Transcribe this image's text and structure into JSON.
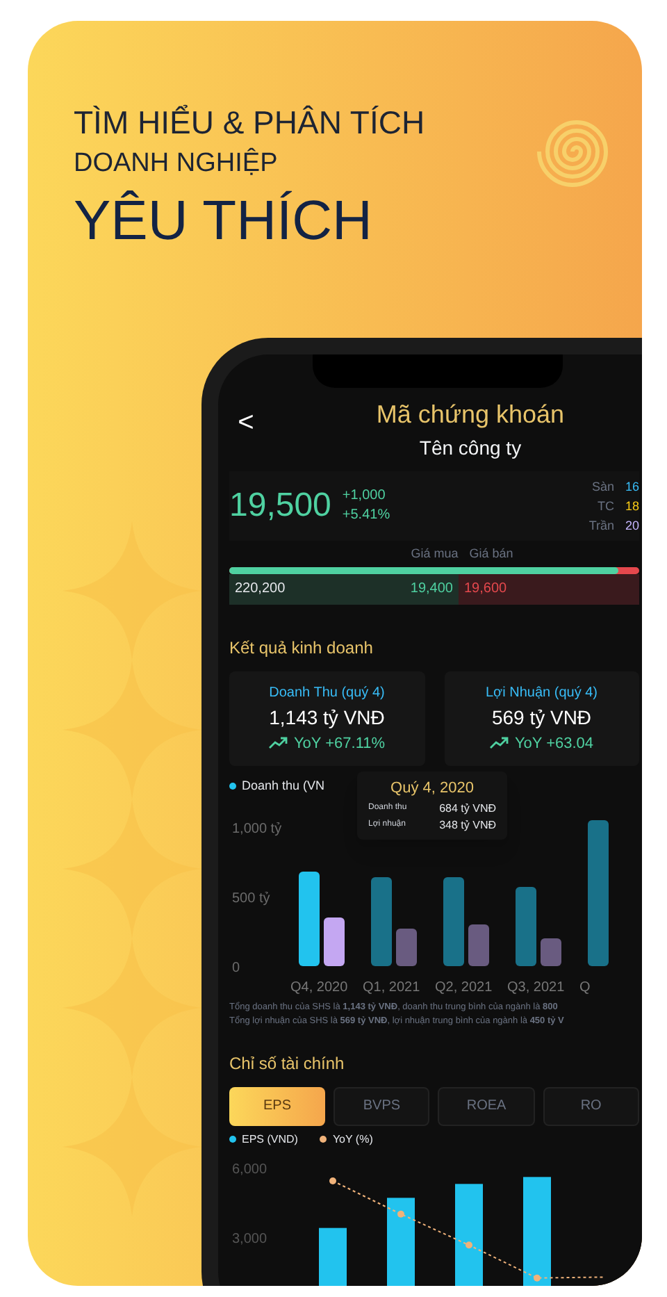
{
  "headline": {
    "line_1": "TÌM HIỂU & PHÂN TÍCH",
    "line_2": "DOANH NGHIỆP",
    "line_3": "YÊU THÍCH"
  },
  "header": {
    "back": "<",
    "title": "Mã chứng khoán",
    "subtitle": "Tên công ty"
  },
  "price": {
    "value": "19,500",
    "change": "+1,000",
    "percent": "+5.41%",
    "refs": [
      {
        "label": "Sàn",
        "value": "16",
        "color": "#38bdf8"
      },
      {
        "label": "TC",
        "value": "18",
        "color": "#facc15"
      },
      {
        "label": "Trần",
        "value": "20",
        "color": "#c4b5fd"
      }
    ]
  },
  "order_book": {
    "bid_label": "Giá mua",
    "ask_label": "Giá bán",
    "level": 0.95,
    "volume": "220,200",
    "bid": "19,400",
    "ask": "19,600"
  },
  "business": {
    "title": "Kết quả kinh doanh",
    "cards": [
      {
        "label": "Doanh Thu (quý 4)",
        "value": "1,143 tỷ VNĐ",
        "yoy": "YoY +67.11%"
      },
      {
        "label": "Lợi Nhuận (quý 4)",
        "value": "569 tỷ VNĐ",
        "yoy": "YoY +63.04"
      }
    ]
  },
  "revenue_chart": {
    "legend": "Doanh thu (VN",
    "selected": [
      true,
      false,
      false,
      false,
      false
    ],
    "tooltip": {
      "title": "Quý 4, 2020",
      "rows": [
        {
          "label": "Doanh thu",
          "value": "684 tỷ VNĐ"
        },
        {
          "label": "Lợi nhuận",
          "value": "348 tỷ VNĐ"
        }
      ]
    },
    "chart_data": {
      "type": "bar",
      "categories": [
        "Q4, 2020",
        "Q1, 2021",
        "Q2, 2021",
        "Q3, 2021",
        "Q"
      ],
      "series": [
        {
          "color": "#22c3ee",
          "values": [
            680,
            640,
            640,
            570,
            1050
          ]
        },
        {
          "color": "#c4a7f2",
          "values": [
            350,
            270,
            300,
            200,
            null
          ]
        }
      ],
      "ylim": [
        0,
        1100
      ],
      "yticks": [
        0,
        {
          "value": 500,
          "label": "500 tỷ"
        },
        {
          "value": 1000,
          "label": "1,000 tỷ"
        }
      ]
    }
  },
  "summary": [
    "Tổng doanh thu của SHS là **1,143 tỷ VNĐ**, doanh thu trung bình của ngành là **800**",
    "Tổng lợi nhuận của SHS là **569 tỷ VNĐ**, lợi nhuận trung bình của ngành là **450 tỷ V**"
  ],
  "ratios": {
    "title": "Chỉ số tài chính",
    "tabs": [
      {
        "label": "EPS",
        "selected": true
      },
      {
        "label": "BVPS",
        "selected": false
      },
      {
        "label": "ROEA",
        "selected": false
      },
      {
        "label": "RO",
        "selected": false
      }
    ],
    "chart_data": {
      "type": "bar",
      "series": [
        {
          "name": "EPS (VND)",
          "color": "#22c3ee",
          "type": "bar",
          "values": [
            3400,
            4700,
            5300,
            5600,
            null
          ]
        },
        {
          "name": "YoY (%)",
          "color": "#f0b27a",
          "type": "line",
          "line_style": "dashed",
          "marker": "circle",
          "values": [
            5430,
            4000,
            2660,
            1240,
            1280
          ]
        }
      ],
      "legend": "top",
      "ylim": [
        900,
        6000
      ],
      "yticks": [
        {
          "value": 3000,
          "label": "3,000"
        },
        {
          "value": 6000,
          "label": "6,000"
        }
      ]
    }
  }
}
